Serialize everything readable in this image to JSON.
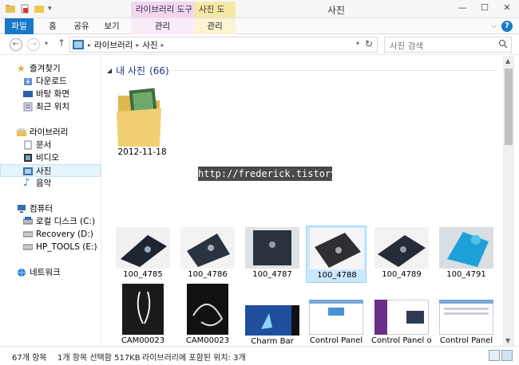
{
  "titlebar": {
    "title": "사진",
    "context_library_tools": "라이브러리 도구",
    "context_picture_tools": "사진 도구",
    "minimize": "—",
    "maximize": "☐",
    "close": "✕"
  },
  "ribbon": {
    "tabs": [
      "파일",
      "홈",
      "공유",
      "보기",
      "관리",
      "관리"
    ],
    "help": "?"
  },
  "address": {
    "breadcrumbs": [
      "라이브러리",
      "사진"
    ],
    "search_placeholder": "사진 검색"
  },
  "navpane": {
    "items": [
      {
        "label": "즐겨찾기",
        "icon": "star-icon"
      },
      {
        "label": "다운로드",
        "icon": "downloads-icon"
      },
      {
        "label": "바탕 화면",
        "icon": "desktop-icon"
      },
      {
        "label": "최근 위치",
        "icon": "recent-places-icon"
      },
      {
        "label": "라이브러리",
        "icon": "libraries-icon"
      },
      {
        "label": "문서",
        "icon": "documents-icon"
      },
      {
        "label": "비디오",
        "icon": "videos-icon"
      },
      {
        "label": "사진",
        "icon": "pictures-icon"
      },
      {
        "label": "음악",
        "icon": "music-icon"
      },
      {
        "label": "컴퓨터",
        "icon": "computer-icon"
      },
      {
        "label": "로컬 디스크 (C:)",
        "icon": "drive-icon"
      },
      {
        "label": "Recovery (D:)",
        "icon": "drive-icon"
      },
      {
        "label": "HP_TOOLS (E:)",
        "icon": "drive-icon"
      },
      {
        "label": "네트워크",
        "icon": "network-icon"
      }
    ]
  },
  "content": {
    "group_title": "내 사진",
    "group_count": "(66)",
    "folder": {
      "label": "2012-11-18"
    },
    "watermark": "http://frederick.tistory.com",
    "thumbs_row1": [
      "100_4785",
      "100_4786",
      "100_4787",
      "100_4788",
      "100_4789",
      "100_4791"
    ],
    "thumbs_row2": [
      "CAM00023",
      "CAM00023",
      "Charm Bar",
      "Control Panel",
      "Control Panel on",
      "Control Panel"
    ]
  },
  "status": {
    "item_count": "67개 항목",
    "selected": "1개 항목 선택함 517KB",
    "location": "라이브러리에 포함된 위치: 3개"
  },
  "colors": {
    "accent": "#1979ca",
    "selection": "#cce8ff",
    "group_title": "#1e3287"
  }
}
